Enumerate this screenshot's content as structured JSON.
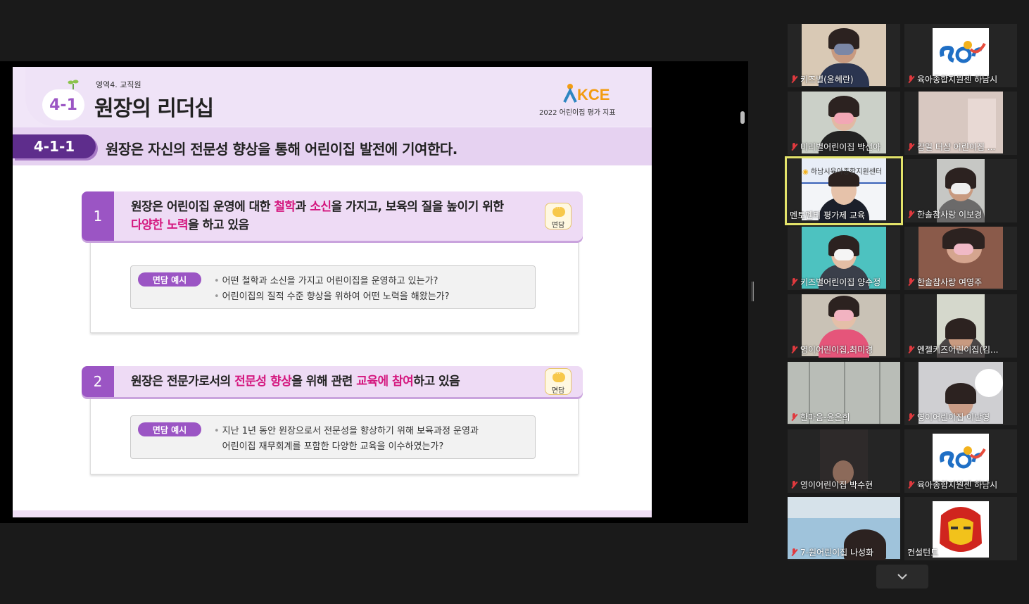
{
  "slide": {
    "area_label": "영역4. 교직원",
    "badge": "4-1",
    "title": "원장의 리더십",
    "logo_text": "KCE",
    "logo_sub": "2022 어린이집 평가 지표",
    "sub_code": "4-1-1",
    "sub_text": "원장은 자신의 전문성 향상을 통해 어린이집 발전에 기여한다.",
    "items": [
      {
        "num": "1",
        "line1_parts": [
          "원장은 어린이집 운영에 대한 ",
          "철학",
          "과 ",
          "소신",
          "을 가지고, 보육의 질을 높이기 위한"
        ],
        "line2_parts": [
          "다양한 노력",
          "을 하고 있음"
        ],
        "button_label": "면담",
        "example_tag": "면담 예시",
        "examples": [
          "어떤 철학과 소신을 가지고 어린이집을 운영하고 있는가?",
          "어린이집의 질적 수준 향상을 위하여 어떤 노력을 해왔는가?"
        ]
      },
      {
        "num": "2",
        "line1_parts": [
          "원장은 전문가로서의 ",
          "전문성 향상",
          "을 위해 관련 ",
          "교육에 참여",
          "하고 있음"
        ],
        "button_label": "면담",
        "example_tag": "면담 예시",
        "examples": [
          "지난 1년 동안 원장으로서 전문성을 향상하기 위해 보육과정 운영과",
          "어린이집 재무회계를 포함한 다양한 교육을 이수하였는가?"
        ]
      }
    ],
    "colors": {
      "accent": "#9b55c4",
      "highlight": "#d4187f",
      "dark": "#5e2d8c"
    }
  },
  "participants": [
    {
      "name": "키즈별(윤혜란)"
    },
    {
      "name": "육아종합지원센 하남시"
    },
    {
      "name": "미리별어린이집 박선아"
    },
    {
      "name": "감일 더샵 어린이집 ..."
    },
    {
      "name": "멘토멘티 평가제 교육",
      "banner": "하남시육아종합지원센터"
    },
    {
      "name": "한솔참사랑 이보경"
    },
    {
      "name": "키즈별어린이집 양수정"
    },
    {
      "name": "한솔참사랑 여영주"
    },
    {
      "name": "영이어린이집,최미경"
    },
    {
      "name": "엔젤키즈어린이집(김..."
    },
    {
      "name": "한마음-윤은희"
    },
    {
      "name": "영이어린이집 이난영"
    },
    {
      "name": "영이어린이집 박수현"
    },
    {
      "name": "육아종합지원센 하남시"
    },
    {
      "name": "7-원어린이집 나성화"
    },
    {
      "name": "컨설턴트"
    }
  ]
}
